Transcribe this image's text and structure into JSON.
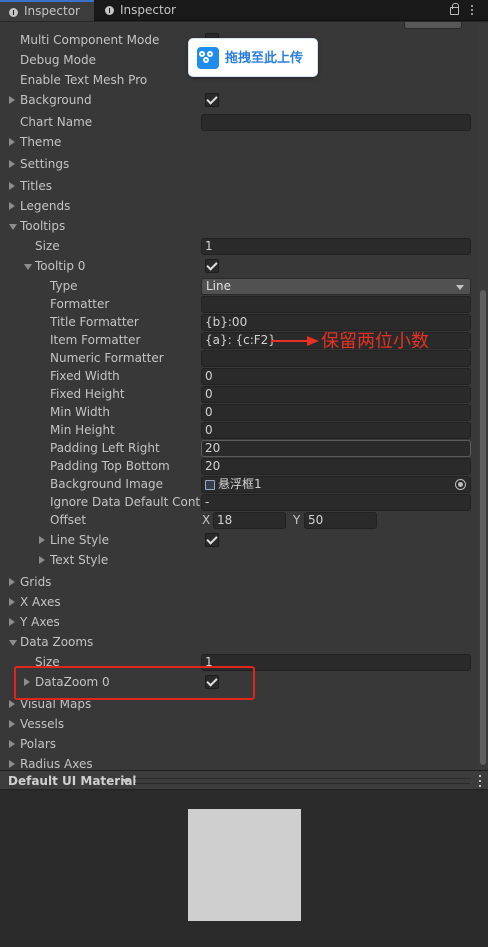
{
  "tabs": [
    {
      "label": "Inspector",
      "active": true
    },
    {
      "label": "Inspector",
      "active": false
    }
  ],
  "upload_button": {
    "label": "拖拽至此上传"
  },
  "rows": [
    {
      "label": "Multi Component Mode",
      "indent": 0,
      "fold": "none",
      "control": "check-hidden"
    },
    {
      "label": "Debug Mode",
      "indent": 0,
      "fold": "none",
      "control": "none"
    },
    {
      "label": "Enable Text Mesh Pro",
      "indent": 0,
      "fold": "none",
      "control": "none"
    },
    {
      "label": "Background",
      "indent": 0,
      "fold": "closed",
      "control": "check",
      "checked": true
    },
    {
      "label": "Chart Name",
      "indent": 0,
      "fold": "none",
      "control": "text",
      "value": ""
    },
    {
      "label": "Theme",
      "indent": 0,
      "fold": "closed",
      "control": "none"
    },
    {
      "label": "Settings",
      "indent": 0,
      "fold": "closed",
      "control": "none"
    },
    {
      "label": "Titles",
      "indent": 0,
      "fold": "closed",
      "control": "none"
    },
    {
      "label": "Legends",
      "indent": 0,
      "fold": "closed",
      "control": "none"
    },
    {
      "label": "Tooltips",
      "indent": 0,
      "fold": "open",
      "control": "none"
    },
    {
      "label": "Size",
      "indent": 1,
      "fold": "none",
      "control": "text",
      "value": "1"
    },
    {
      "label": "Tooltip 0",
      "indent": 1,
      "fold": "open",
      "control": "check",
      "checked": true
    },
    {
      "label": "Type",
      "indent": 2,
      "fold": "none",
      "control": "dropdown",
      "value": "Line"
    },
    {
      "label": "Formatter",
      "indent": 2,
      "fold": "none",
      "control": "text",
      "value": ""
    },
    {
      "label": "Title Formatter",
      "indent": 2,
      "fold": "none",
      "control": "text",
      "value": "{b}:00"
    },
    {
      "label": "Item Formatter",
      "indent": 2,
      "fold": "none",
      "control": "text",
      "value": "{a}: {c:F2}"
    },
    {
      "label": "Numeric Formatter",
      "indent": 2,
      "fold": "none",
      "control": "text",
      "value": ""
    },
    {
      "label": "Fixed Width",
      "indent": 2,
      "fold": "none",
      "control": "text",
      "value": "0"
    },
    {
      "label": "Fixed Height",
      "indent": 2,
      "fold": "none",
      "control": "text",
      "value": "0"
    },
    {
      "label": "Min Width",
      "indent": 2,
      "fold": "none",
      "control": "text",
      "value": "0"
    },
    {
      "label": "Min Height",
      "indent": 2,
      "fold": "none",
      "control": "text",
      "value": "0"
    },
    {
      "label": "Padding Left Right",
      "indent": 2,
      "fold": "none",
      "control": "text-focus",
      "value": "20"
    },
    {
      "label": "Padding Top Bottom",
      "indent": 2,
      "fold": "none",
      "control": "text",
      "value": "20"
    },
    {
      "label": "Background Image",
      "indent": 2,
      "fold": "none",
      "control": "object",
      "value": "悬浮框1"
    },
    {
      "label": "Ignore Data Default Content",
      "indent": 2,
      "fold": "none",
      "control": "text",
      "value": "-"
    },
    {
      "label": "Offset",
      "indent": 2,
      "fold": "none",
      "control": "xy",
      "x_label": "X",
      "x": "18",
      "y_label": "Y",
      "y": "50"
    },
    {
      "label": "Line Style",
      "indent": 2,
      "fold": "closed",
      "control": "check",
      "checked": true
    },
    {
      "label": "Text Style",
      "indent": 2,
      "fold": "closed",
      "control": "none"
    },
    {
      "label": "Grids",
      "indent": 0,
      "fold": "closed",
      "control": "none"
    },
    {
      "label": "X Axes",
      "indent": 0,
      "fold": "closed",
      "control": "none"
    },
    {
      "label": "Y Axes",
      "indent": 0,
      "fold": "closed",
      "control": "none"
    },
    {
      "label": "Data Zooms",
      "indent": 0,
      "fold": "open",
      "control": "none"
    },
    {
      "label": "Size",
      "indent": 1,
      "fold": "none",
      "control": "text",
      "value": "1"
    },
    {
      "label": "DataZoom 0",
      "indent": 1,
      "fold": "closed",
      "control": "check",
      "checked": true
    },
    {
      "label": "Visual Maps",
      "indent": 0,
      "fold": "closed",
      "control": "none"
    },
    {
      "label": "Vessels",
      "indent": 0,
      "fold": "closed",
      "control": "none"
    },
    {
      "label": "Polars",
      "indent": 0,
      "fold": "closed",
      "control": "none"
    },
    {
      "label": "Radius Axes",
      "indent": 0,
      "fold": "closed",
      "control": "none"
    }
  ],
  "annotation": {
    "text": "保留两位小数",
    "color": "#e53125"
  },
  "material": {
    "title": "Default UI Material"
  },
  "colors": {
    "panel": "#383838",
    "field": "#2a2a2a",
    "accent": "#3a72c9",
    "highlight": "#e0261a",
    "upload": "#1f8cf0"
  }
}
